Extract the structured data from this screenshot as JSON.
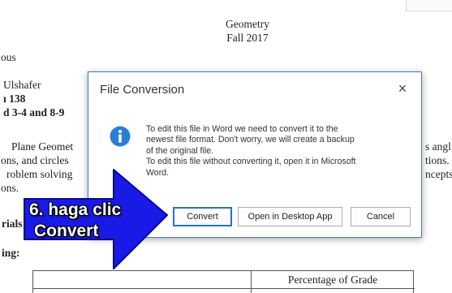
{
  "document": {
    "title_line1": "Geometry",
    "title_line2": "Fall 2017",
    "lines": [
      "ous",
      "Ulshafer",
      "ı 138",
      "d 3-4 and 8-9",
      "Plane Geomet",
      "ons, and circles",
      "roblem solving",
      "ons.",
      "rials",
      "ing:",
      "s angl",
      "tions.",
      "ncepts"
    ],
    "table_header": "Percentage of Grade"
  },
  "dialog": {
    "title": "File Conversion",
    "close_glyph": "×",
    "message_lines": [
      "To edit this file in Word we need to convert it to the",
      "newest file format. Don't worry, we will create a backup",
      "of the original file.",
      "To edit this file without converting it, open it in Microsoft",
      "Word."
    ],
    "buttons": {
      "convert": "Convert",
      "open_desktop": "Open in Desktop App",
      "cancel": "Cancel"
    },
    "icon": "info-icon",
    "accent_color": "#2b6ed0"
  },
  "callout": {
    "line1": "6. haga clic",
    "line2": "Convert",
    "fill_color": "#1a1ae6",
    "icon": "arrow-right-icon"
  }
}
